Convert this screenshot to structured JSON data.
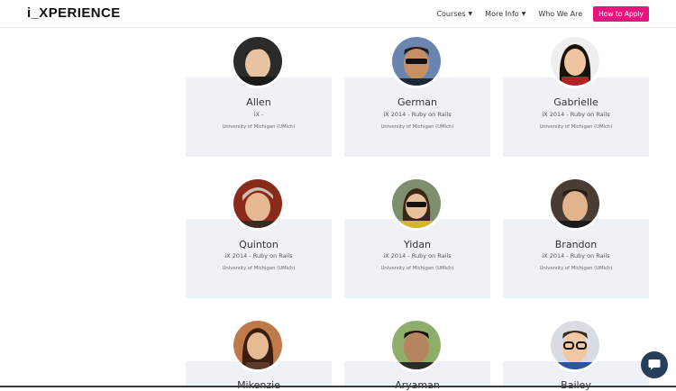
{
  "header": {
    "logo": "i_XPERIENCE",
    "nav": {
      "courses": "Courses",
      "more_info": "More Info",
      "who_we_are": "Who We Are",
      "apply": "How to Apply"
    },
    "colors": {
      "apply_bg": "#e8137f"
    }
  },
  "students": [
    {
      "name": "Allen",
      "program": "iX -",
      "school": "University of Michigan (UMich)"
    },
    {
      "name": "German",
      "program": "iX 2014 - Ruby on Rails",
      "school": "University of Michigan (UMich)"
    },
    {
      "name": "Gabrielle",
      "program": "iX 2014 - Ruby on Rails",
      "school": "University of Michigan (UMich)"
    },
    {
      "name": "Quinton",
      "program": "iX 2014 - Ruby on Rails",
      "school": "University of Michigan (UMich)"
    },
    {
      "name": "Yidan",
      "program": "iX 2014 - Ruby on Rails",
      "school": "University of Michigan (UMich)"
    },
    {
      "name": "Brandon",
      "program": "iX 2014 - Ruby on Rails",
      "school": "University of Michigan (UMich)"
    },
    {
      "name": "Mikenzie",
      "program": "",
      "school": ""
    },
    {
      "name": "Aryaman",
      "program": "",
      "school": ""
    },
    {
      "name": "Bailey",
      "program": "",
      "school": ""
    }
  ],
  "chat": {
    "icon": "chat-bubble-icon"
  }
}
